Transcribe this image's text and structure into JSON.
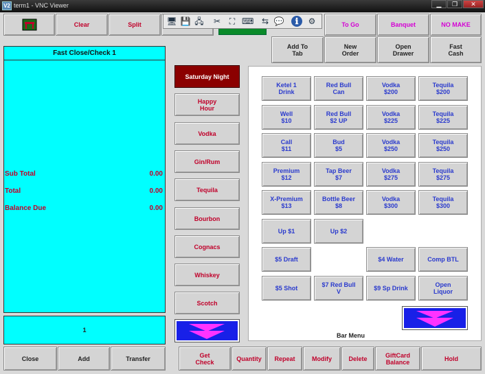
{
  "window": {
    "title": "term1 - VNC Viewer",
    "app_icon": "V2",
    "controls": [
      "▁",
      "❐",
      "✕"
    ]
  },
  "toolbar": {
    "icons": [
      "computer-icon",
      "save-icon",
      "network-icon",
      "tools-icon",
      "fullscreen-icon",
      "keyboard-icon",
      "transfer-icon",
      "chat-icon",
      "info-icon",
      "options-icon"
    ],
    "glyphs": [
      "🖥",
      "💾",
      "🖧",
      "✂",
      "⛶",
      "⌨",
      "⇆",
      "💬",
      "ℹ",
      "⚙"
    ]
  },
  "top_row": {
    "clear": "Clear",
    "split": "Split",
    "to_go": "To Go",
    "banquet": "Banquet",
    "no_make": "NO MAKE"
  },
  "action_row": {
    "add_to_tab": "Add To\nTab",
    "new_order": "New\nOrder",
    "open_drawer": "Open\nDrawer",
    "fast_cash": "Fast\nCash"
  },
  "check": {
    "title": "Fast Close/Check 1",
    "sub_total_label": "Sub Total",
    "sub_total": "0.00",
    "total_label": "Total",
    "total": "0.00",
    "balance_due_label": "Balance Due",
    "balance_due": "0.00",
    "seat": "1"
  },
  "categories": [
    "Saturday Night",
    "Happy\nHour",
    "Vodka",
    "Gin/Rum",
    "Tequila",
    "Bourbon",
    "Cognacs",
    "Whiskey",
    "Scotch"
  ],
  "menu": {
    "label": "Bar Menu",
    "items": [
      [
        "Ketel 1\nDrink",
        "Red Bull\nCan",
        "Vodka\n$200",
        "Tequila\n$200"
      ],
      [
        "Well\n$10",
        "Red Bull\n$2 UP",
        "Vodka\n$225",
        "Tequila\n$225"
      ],
      [
        "Call\n$11",
        "Bud\n$5",
        "Vodka\n$250",
        "Tequila\n$250"
      ],
      [
        "Premium\n$12",
        "Tap Beer\n$7",
        "Vodka\n$275",
        "Tequila\n$275"
      ],
      [
        "X-Premium\n$13",
        "Bottle Beer\n$8",
        "Vodka\n$300",
        "Tequila\n$300"
      ],
      [
        "Up $1",
        "Up $2",
        "",
        ""
      ],
      [
        "$5 Draft",
        "",
        "$4 Water",
        "Comp BTL"
      ],
      [
        "$5 Shot",
        "$7 Red Bull\nV",
        "$9 Sp Drink",
        "Open\nLiquor"
      ]
    ]
  },
  "bottom": {
    "close": "Close",
    "add": "Add",
    "transfer": "Transfer",
    "get_check": "Get\nCheck",
    "quantity": "Quantity",
    "repeat": "Repeat",
    "modify": "Modify",
    "delete": "Delete",
    "giftcard": "GiftCard\nBalance",
    "hold": "Hold"
  },
  "colors": {
    "check_bg": "#00ffff",
    "selected_category": "#8b0000",
    "arrow_button": "#1820e8",
    "menu_bg": "#ffffff"
  }
}
